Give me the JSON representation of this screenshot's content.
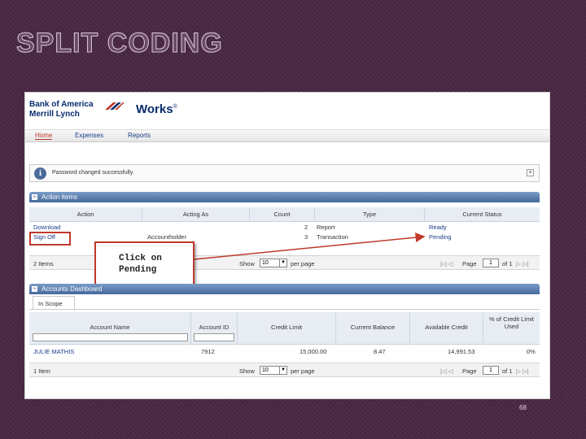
{
  "slide": {
    "title": "SPLIT CODING",
    "page_number": "68"
  },
  "header": {
    "bank_line1": "Bank of America",
    "bank_line2": "Merrill Lynch",
    "app_name": "Works",
    "trademark": "®"
  },
  "nav": {
    "tabs": [
      {
        "label": "Home",
        "active": true
      },
      {
        "label": "Expenses",
        "active": false
      },
      {
        "label": "Reports",
        "active": false
      }
    ]
  },
  "message": {
    "icon": "info-icon",
    "text": "Password changed successfully.",
    "close": "×"
  },
  "action_items": {
    "title": "Action Items",
    "columns": [
      "Action",
      "Acting As",
      "Count",
      "Type",
      "Current Status"
    ],
    "rows": [
      {
        "action": "Download",
        "acting_as": "",
        "count": "2",
        "type": "Report",
        "status": "Ready"
      },
      {
        "action": "Sign Off",
        "acting_as": "Accountholder",
        "count": "3",
        "type": "Transaction",
        "status": "Pending"
      }
    ],
    "footer": {
      "items_count": "2 Items",
      "show_label": "Show",
      "page_size": "10",
      "per_page_label": "per page",
      "first_prev": "|◁ ◁",
      "page_label": "Page",
      "page_value": "1",
      "of_label": "of 1",
      "next_last": "▷ ▷|"
    }
  },
  "callout": {
    "text_line1": "Click on",
    "text_line2": "Pending"
  },
  "accounts": {
    "title": "Accounts Dashboard",
    "scope_tab": "In Scope",
    "columns": [
      "Account Name",
      "Account ID",
      "Credit Limit",
      "Current Balance",
      "Available Credit",
      "% of Credit Limit Used"
    ],
    "rows": [
      {
        "name": "JULIE MATHIS",
        "id": "7912",
        "credit_limit": "15,000.00",
        "balance": "8.47",
        "available": "14,991.53",
        "pct": "0%"
      }
    ],
    "footer": {
      "items_count": "1 Item",
      "show_label": "Show",
      "page_size": "10",
      "per_page_label": "per page",
      "first_prev": "|◁ ◁",
      "page_label": "Page",
      "page_value": "1",
      "of_label": "of 1",
      "next_last": "▷ ▷|"
    }
  },
  "colors": {
    "accent_red": "#c0392b",
    "panel_blue": "#46699d",
    "link_blue": "#1a3d8a"
  }
}
